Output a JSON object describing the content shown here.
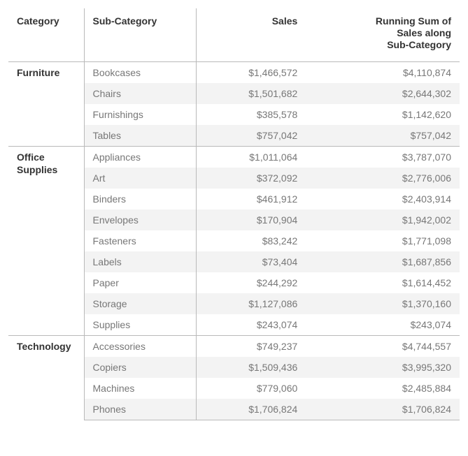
{
  "headers": {
    "category": "Category",
    "sub_category": "Sub-Category",
    "sales": "Sales",
    "running_l1": "Running Sum of",
    "running_l2": "Sales along",
    "running_l3": "Sub-Category"
  },
  "groups": [
    {
      "category": "Furniture",
      "rows": [
        {
          "sub": "Bookcases",
          "sales": "$1,466,572",
          "running": "$4,110,874"
        },
        {
          "sub": "Chairs",
          "sales": "$1,501,682",
          "running": "$2,644,302"
        },
        {
          "sub": "Furnishings",
          "sales": "$385,578",
          "running": "$1,142,620"
        },
        {
          "sub": "Tables",
          "sales": "$757,042",
          "running": "$757,042"
        }
      ]
    },
    {
      "category": "Office\nSupplies",
      "rows": [
        {
          "sub": "Appliances",
          "sales": "$1,011,064",
          "running": "$3,787,070"
        },
        {
          "sub": "Art",
          "sales": "$372,092",
          "running": "$2,776,006"
        },
        {
          "sub": "Binders",
          "sales": "$461,912",
          "running": "$2,403,914"
        },
        {
          "sub": "Envelopes",
          "sales": "$170,904",
          "running": "$1,942,002"
        },
        {
          "sub": "Fasteners",
          "sales": "$83,242",
          "running": "$1,771,098"
        },
        {
          "sub": "Labels",
          "sales": "$73,404",
          "running": "$1,687,856"
        },
        {
          "sub": "Paper",
          "sales": "$244,292",
          "running": "$1,614,452"
        },
        {
          "sub": "Storage",
          "sales": "$1,127,086",
          "running": "$1,370,160"
        },
        {
          "sub": "Supplies",
          "sales": "$243,074",
          "running": "$243,074"
        }
      ]
    },
    {
      "category": "Technology",
      "rows": [
        {
          "sub": "Accessories",
          "sales": "$749,237",
          "running": "$4,744,557"
        },
        {
          "sub": "Copiers",
          "sales": "$1,509,436",
          "running": "$3,995,320"
        },
        {
          "sub": "Machines",
          "sales": "$779,060",
          "running": "$2,485,884"
        },
        {
          "sub": "Phones",
          "sales": "$1,706,824",
          "running": "$1,706,824"
        }
      ]
    }
  ]
}
